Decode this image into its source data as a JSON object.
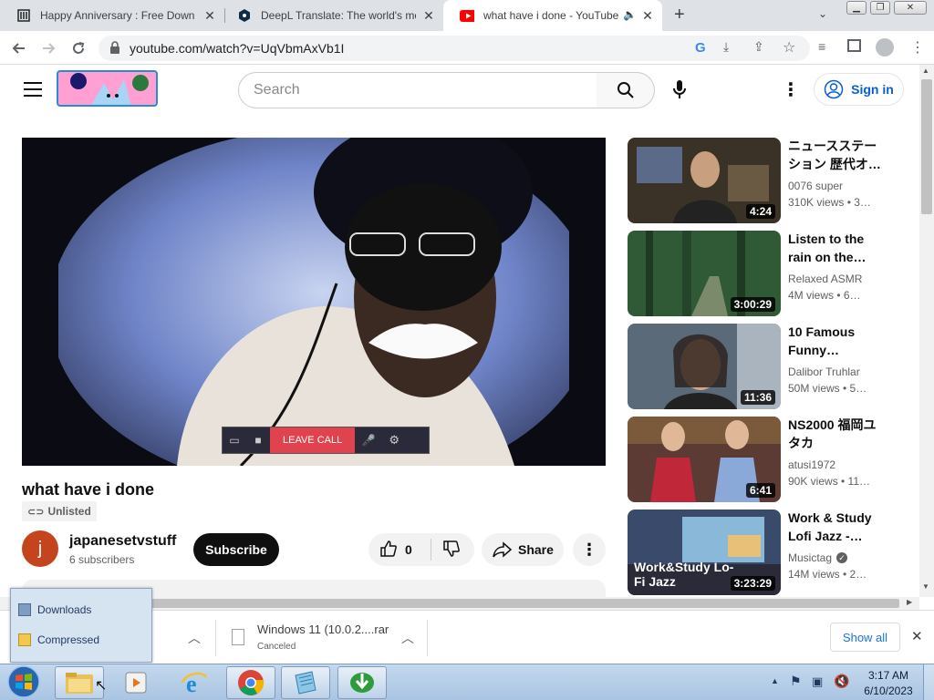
{
  "browser": {
    "tabs": [
      {
        "title": "Happy Anniversary : Free Downlo"
      },
      {
        "title": "DeepL Translate: The world's mo"
      },
      {
        "title": "what have i done - YouTube"
      }
    ],
    "new_tab": "+",
    "url": "youtube.com/watch?v=UqVbmAxVb1I"
  },
  "youtube": {
    "search_placeholder": "Search",
    "sign_in": "Sign in",
    "video": {
      "title": "what have i done",
      "badge": "Unlisted",
      "leave_call": "LEAVE CALL",
      "channel": "japanesetvstuff",
      "channel_initial": "j",
      "subscribers": "6 subscribers",
      "subscribe": "Subscribe",
      "likes": "0",
      "share": "Share"
    },
    "related": [
      {
        "title": "ニュースステーション 歴代オ…",
        "channel": "0076 super",
        "meta": "310K views  • 3…",
        "duration": "4:24",
        "thumb_color": "#3a3226"
      },
      {
        "title": "Listen to the rain on the…",
        "channel": "Relaxed ASMR",
        "meta": "4M views  • 6…",
        "duration": "3:00:29",
        "thumb_color": "#2f5a35"
      },
      {
        "title": "10 Famous Funny…",
        "channel": "Dalibor Truhlar",
        "meta": "50M views  • 5…",
        "duration": "11:36",
        "thumb_color": "#5a6a78"
      },
      {
        "title": "NS2000 福岡ユタカ",
        "channel": "atusi1972",
        "meta": "90K views  • 11…",
        "duration": "6:41",
        "thumb_color": "#5b3b34"
      },
      {
        "title": "Work & Study Lofi Jazz -…",
        "channel": "Musictag",
        "meta": "14M views  • 2…",
        "duration": "3:23:29",
        "thumb_color": "#3a4a6a",
        "thumb_text": "Work&Study Lo-Fi Jazz"
      }
    ]
  },
  "downloads": {
    "popup_items": [
      "Downloads",
      "Compressed"
    ],
    "file_name": "Windows 11 (10.0.2....rar",
    "file_status": "Canceled",
    "show_all": "Show all"
  },
  "taskbar": {
    "time": "3:17 AM",
    "date": "6/10/2023"
  }
}
